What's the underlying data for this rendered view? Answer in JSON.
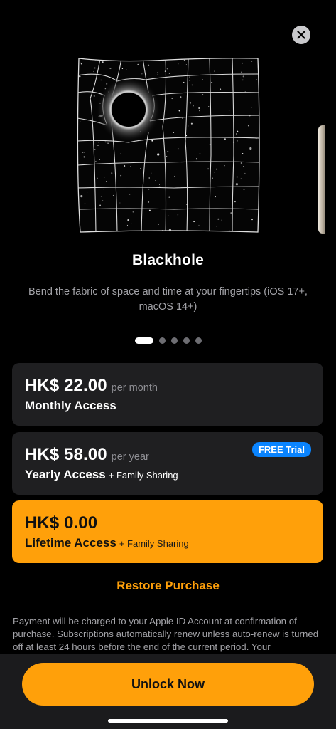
{
  "close": {
    "icon": "close-icon"
  },
  "feature": {
    "title": "Blackhole",
    "description": "Bend the fabric of space and time at your fingertips (iOS 17+, macOS 14+)"
  },
  "pager": {
    "count": 5,
    "active_index": 0
  },
  "plans": [
    {
      "price": "HK$ 22.00",
      "period": "per month",
      "name": "Monthly Access",
      "extra": "",
      "badge": "",
      "selected": false
    },
    {
      "price": "HK$ 58.00",
      "period": "per year",
      "name": "Yearly Access",
      "extra": "+ Family Sharing",
      "badge": "FREE Trial",
      "selected": false
    },
    {
      "price": "HK$ 0.00",
      "period": "",
      "name": "Lifetime Access",
      "extra": "+ Family Sharing",
      "badge": "",
      "selected": true
    }
  ],
  "restore_label": "Restore Purchase",
  "legal_text": "Payment will be charged to your Apple ID Account at confirmation of purchase. Subscriptions automatically renew unless auto-renew is turned off at least 24 hours before the end of the current period. Your",
  "cta_label": "Unlock Now",
  "colors": {
    "accent": "#ffa00a",
    "badge": "#0a84ff",
    "card": "#1f1f21",
    "background": "#000000"
  }
}
